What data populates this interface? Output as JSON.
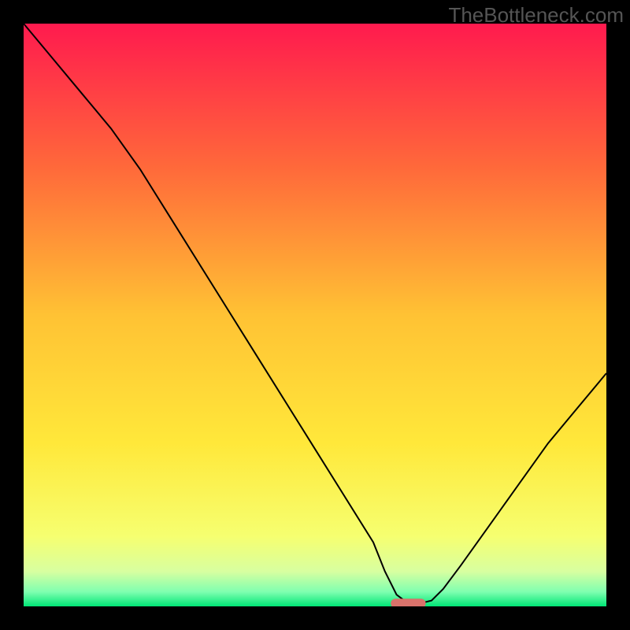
{
  "watermark": "TheBottleneck.com",
  "chart_data": {
    "type": "line",
    "title": "",
    "xlabel": "",
    "ylabel": "",
    "xlim": [
      0,
      100
    ],
    "ylim": [
      0,
      100
    ],
    "x": [
      0,
      5,
      10,
      15,
      20,
      25,
      30,
      35,
      40,
      45,
      50,
      55,
      60,
      62,
      64,
      66,
      68,
      70,
      72,
      75,
      80,
      85,
      90,
      95,
      100
    ],
    "values": [
      100,
      94,
      88,
      82,
      75,
      67,
      59,
      51,
      43,
      35,
      27,
      19,
      11,
      6,
      2,
      0.5,
      0.5,
      1,
      3,
      7,
      14,
      21,
      28,
      34,
      40
    ],
    "marker": {
      "x_start": 63,
      "x_end": 69,
      "y": 0.5
    },
    "gradient_stops": [
      {
        "offset": 0.0,
        "color": "#ff1a4e"
      },
      {
        "offset": 0.25,
        "color": "#ff6a3a"
      },
      {
        "offset": 0.5,
        "color": "#ffc234"
      },
      {
        "offset": 0.72,
        "color": "#ffe83a"
      },
      {
        "offset": 0.88,
        "color": "#f6ff70"
      },
      {
        "offset": 0.94,
        "color": "#d8ffa0"
      },
      {
        "offset": 0.975,
        "color": "#7fffb0"
      },
      {
        "offset": 1.0,
        "color": "#00e676"
      }
    ],
    "marker_color": "#d9726b",
    "line_color": "#000000"
  },
  "plot": {
    "bg": "#000000",
    "inner_size": 740,
    "margin": 30
  }
}
